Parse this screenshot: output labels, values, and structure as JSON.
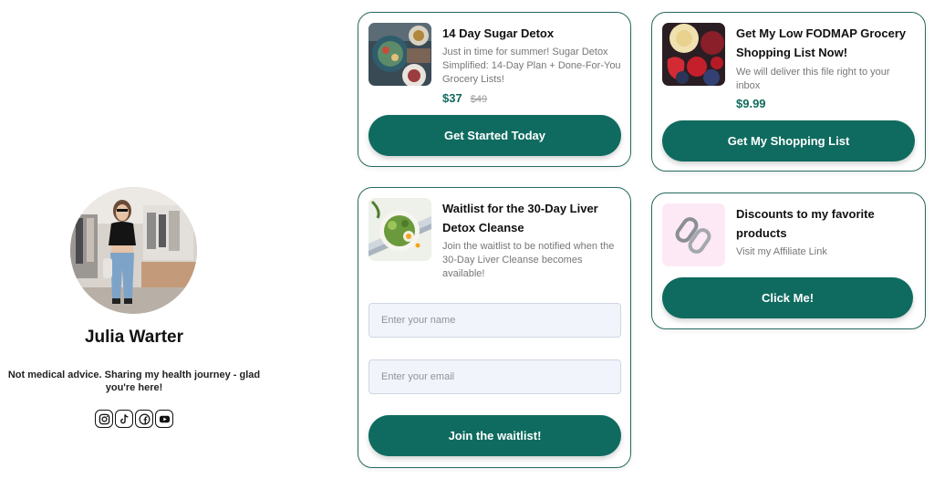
{
  "profile": {
    "name": "Julia Warter",
    "bio": "Not medical advice. Sharing my health journey - glad you're here!",
    "socials": [
      "instagram-icon",
      "tiktok-icon",
      "facebook-icon",
      "youtube-icon"
    ]
  },
  "cards": {
    "sugar_detox": {
      "title": "14 Day Sugar Detox",
      "description": "Just in time for summer! Sugar Detox Simplified: 14-Day Plan + Done-For-You Grocery Lists!",
      "price": "$37",
      "old_price": "$49",
      "button": "Get Started Today"
    },
    "fodmap": {
      "title": "Get My Low FODMAP Grocery Shopping List Now!",
      "description": "We will deliver this file right to your inbox",
      "price": "$9.99",
      "button": "Get My Shopping List"
    },
    "liver_detox": {
      "title": "Waitlist for the 30-Day Liver Detox Cleanse",
      "description": "Join the waitlist to be notified when the 30-Day Liver Cleanse becomes available!",
      "name_placeholder": "Enter your name",
      "email_placeholder": "Enter your email",
      "button": "Join the waitlist!"
    },
    "affiliate": {
      "title": "Discounts to my favorite products",
      "description": "Visit my Affiliate Link",
      "button": "Click Me!"
    }
  },
  "colors": {
    "accent": "#0f6b5f",
    "card_border": "#27695f",
    "price": "#116a5d",
    "input_bg": "#f1f4fb",
    "link_thumb_bg": "#fde9f6"
  }
}
